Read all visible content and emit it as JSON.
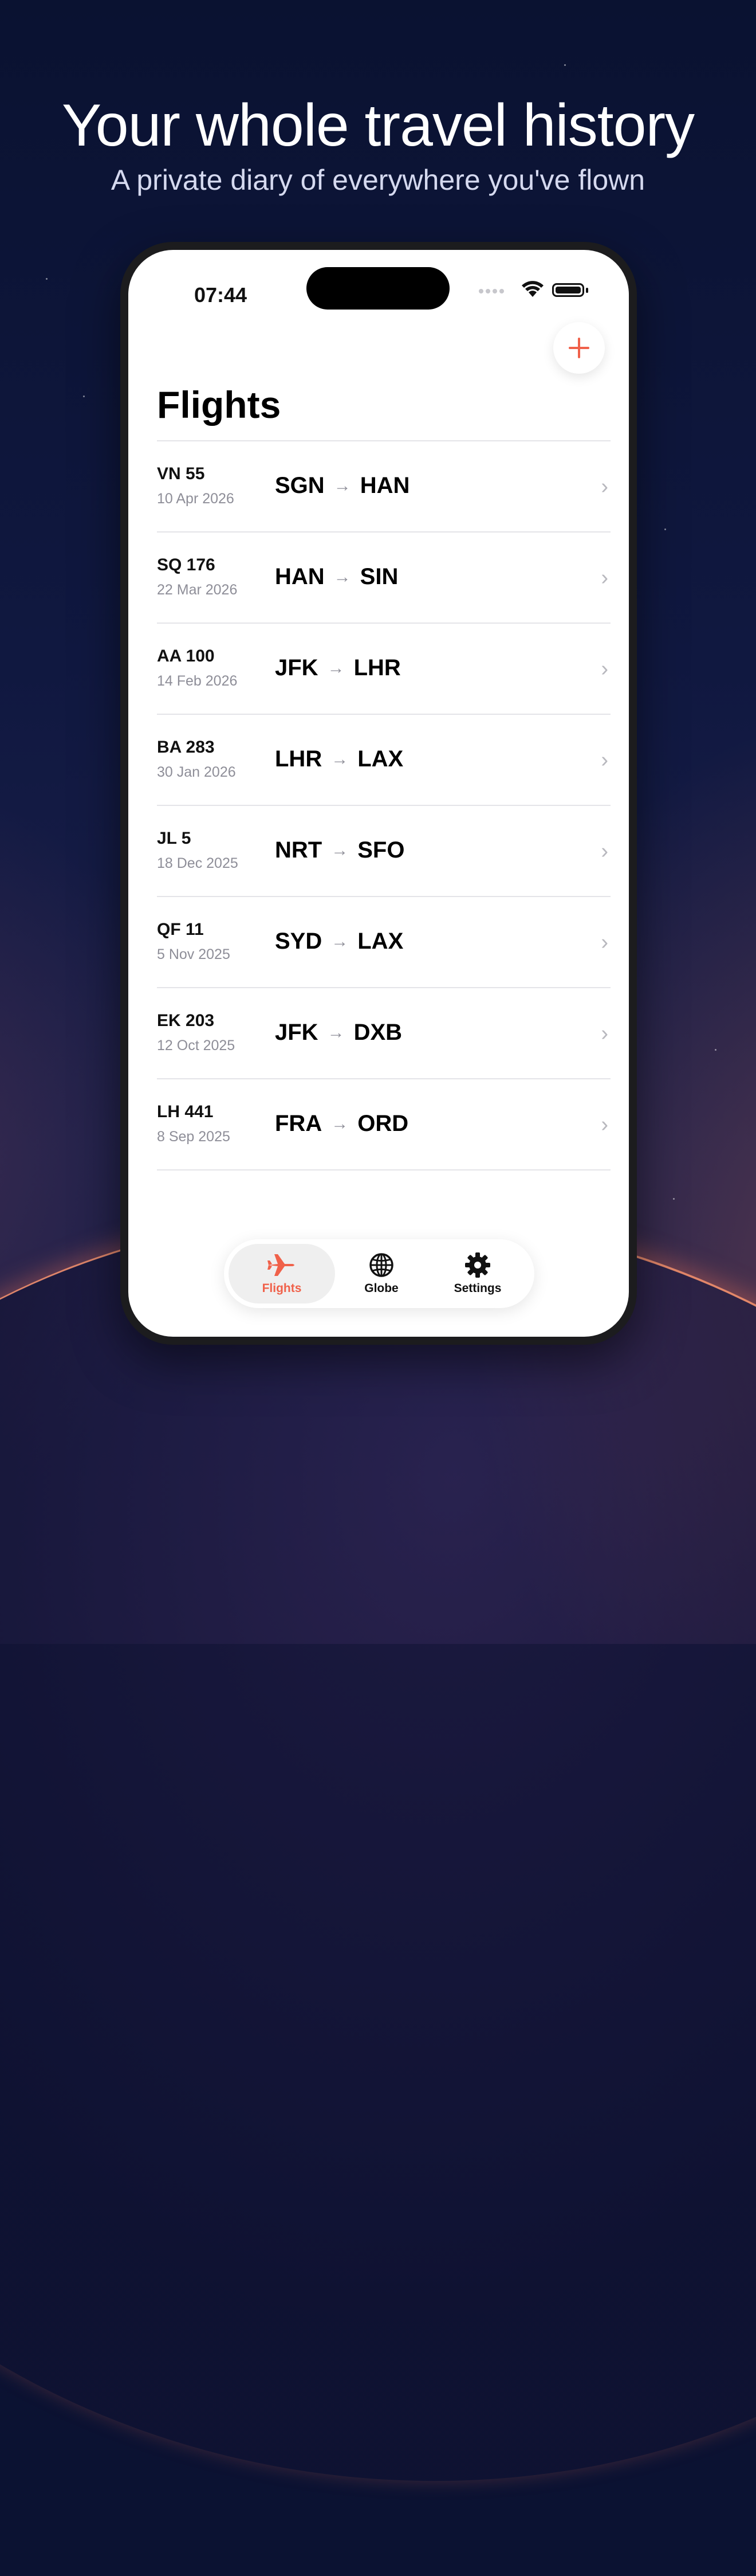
{
  "marketing": {
    "headline": "Your whole travel history",
    "subheadline": "A private diary of everywhere you've flown"
  },
  "status_bar": {
    "time": "07:44"
  },
  "header": {
    "title": "Flights",
    "add_icon": "plus-icon"
  },
  "flights": [
    {
      "number": "VN 55",
      "date": "10 Apr 2026",
      "from": "SGN",
      "to": "HAN"
    },
    {
      "number": "SQ 176",
      "date": "22 Mar 2026",
      "from": "HAN",
      "to": "SIN"
    },
    {
      "number": "AA 100",
      "date": "14 Feb 2026",
      "from": "JFK",
      "to": "LHR"
    },
    {
      "number": "BA 283",
      "date": "30 Jan 2026",
      "from": "LHR",
      "to": "LAX"
    },
    {
      "number": "JL 5",
      "date": "18 Dec 2025",
      "from": "NRT",
      "to": "SFO"
    },
    {
      "number": "QF 11",
      "date": "5 Nov 2025",
      "from": "SYD",
      "to": "LAX"
    },
    {
      "number": "EK 203",
      "date": "12 Oct 2025",
      "from": "JFK",
      "to": "DXB"
    },
    {
      "number": "LH 441",
      "date": "8 Sep 2025",
      "from": "FRA",
      "to": "ORD"
    }
  ],
  "tabbar": {
    "tabs": [
      {
        "label": "Flights",
        "icon": "airplane-icon",
        "active": true
      },
      {
        "label": "Globe",
        "icon": "globe-icon",
        "active": false
      },
      {
        "label": "Settings",
        "icon": "gear-icon",
        "active": false
      }
    ]
  },
  "colors": {
    "accent": "#f0614a",
    "background": "#0b1232",
    "text_primary": "#000000",
    "text_secondary": "#8e8e98"
  }
}
